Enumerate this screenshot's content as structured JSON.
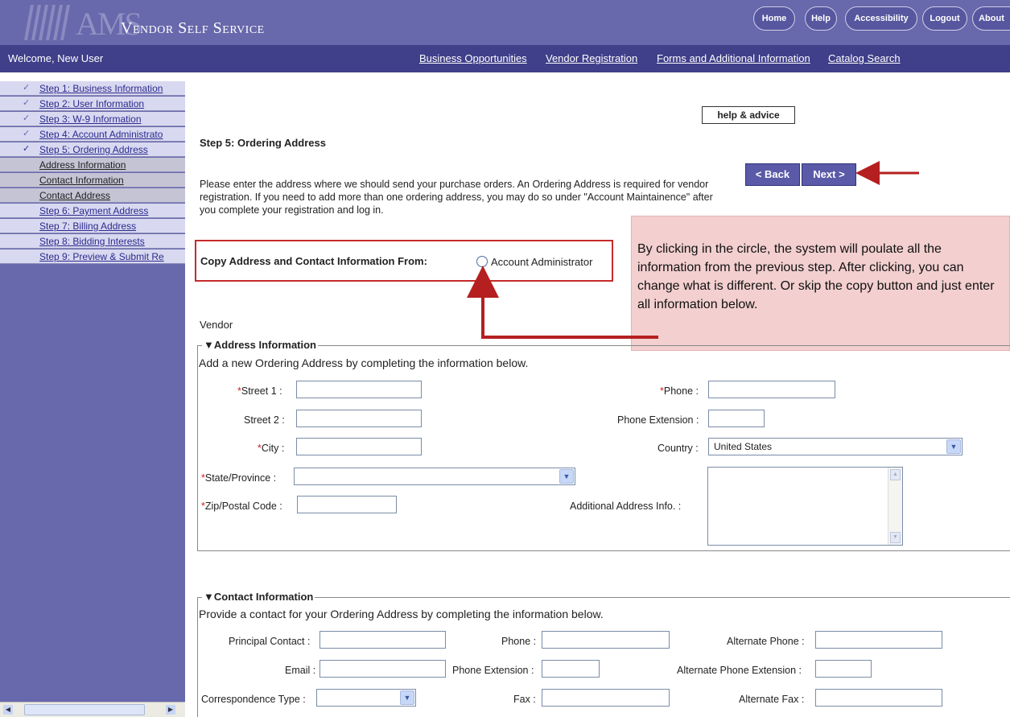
{
  "header": {
    "logo_am": "AMS",
    "logo_text": "Vendor Self Service",
    "nav_buttons": [
      "Home",
      "Help",
      "Accessibility",
      "Logout",
      "About"
    ]
  },
  "welcome_bar": {
    "welcome": "Welcome, New User",
    "links": [
      "Business Opportunities",
      "Vendor Registration",
      "Forms and Additional Information",
      "Catalog Search"
    ]
  },
  "sidebar": {
    "items": [
      {
        "label": "Step 1: Business Information",
        "checked": true
      },
      {
        "label": "Step 2: User Information",
        "checked": true
      },
      {
        "label": "Step 3: W-9 Information",
        "checked": true
      },
      {
        "label": "Step 4: Account Administrato",
        "checked": true
      },
      {
        "label": "Step 5: Ordering Address",
        "checked": true
      },
      {
        "label": "Address Information",
        "checked": false
      },
      {
        "label": "Contact Information",
        "checked": false
      },
      {
        "label": "Contact Address",
        "checked": false
      },
      {
        "label": "Step 6: Payment Address",
        "checked": false
      },
      {
        "label": "Step 7: Billing Address",
        "checked": false
      },
      {
        "label": "Step 8: Bidding Interests",
        "checked": false
      },
      {
        "label": "Step 9: Preview & Submit Re",
        "checked": false
      }
    ],
    "check_mark": "✓"
  },
  "main": {
    "help_advice": "help & advice",
    "title": "Step 5: Ordering Address",
    "intro": "Please enter the address where we should send your purchase orders. An Ordering Address is required for vendor registration. If you need to add more than one ordering address, you may do so under \"Account Maintainence\" after you complete your registration and log in.",
    "back_label": "< Back",
    "next_label": "Next >",
    "copy_label": "Copy Address and Contact Information From:",
    "copy_option": "Account Administrator",
    "callout": "By clicking in the circle, the system will poulate all the information from the previous step.  After clicking, you can change what is different.  Or skip the copy button and just enter all information below.",
    "vendor_label": "Vendor"
  },
  "address": {
    "legend": "▼Address Information",
    "instructions": "Add a new Ordering Address by completing the information below.",
    "street1": "Street 1 :",
    "street2": "Street 2 :",
    "city": "City :",
    "state": "State/Province :",
    "zip": "Zip/Postal Code :",
    "phone": "Phone :",
    "phone_ext": "Phone Extension :",
    "country": "Country :",
    "country_value": "United States",
    "additional": "Additional Address Info. :"
  },
  "contact": {
    "legend": "▼Contact Information",
    "instructions": "Provide a contact for your Ordering Address by completing the information below.",
    "principal": "Principal Contact :",
    "email": "Email :",
    "corr_type": "Correspondence Type :",
    "phone": "Phone :",
    "phone_ext": "Phone Extension :",
    "fax": "Fax :",
    "alt_phone": "Alternate Phone :",
    "alt_phone_ext": "Alternate Phone Extension :",
    "alt_fax": "Alternate Fax :"
  },
  "colors": {
    "header_bg": "#6868ac",
    "welcome_bg": "#3f3f8a",
    "callout_bg": "#f3cfcf",
    "arrow": "#b51f1f",
    "required": "#d31d1d"
  },
  "icons": [
    "dropdown-arrow-icon",
    "checkmark-icon",
    "scroll-arrow-icon",
    "collapse-triangle-icon"
  ]
}
